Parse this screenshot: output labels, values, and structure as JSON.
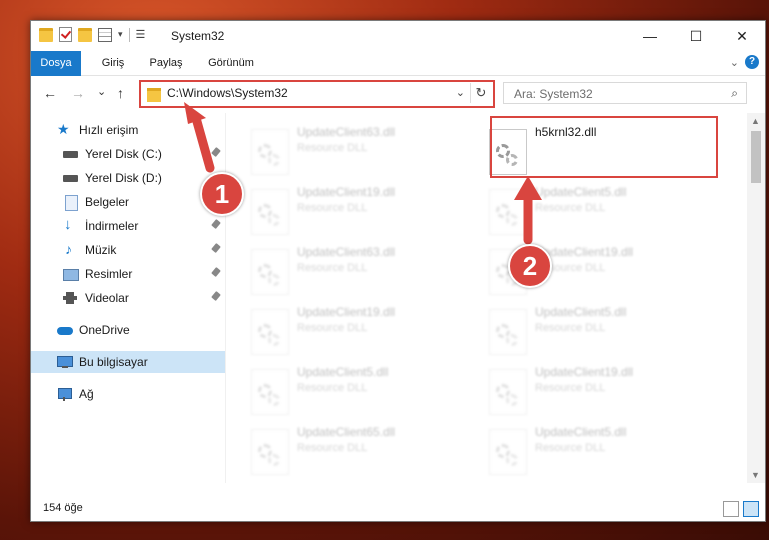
{
  "window": {
    "title": "System32",
    "controls": {
      "minimize": "—",
      "maximize": "☐",
      "close": "✕"
    }
  },
  "ribbon": {
    "tabs": [
      "Dosya",
      "Giriş",
      "Paylaş",
      "Görünüm"
    ],
    "help": "?"
  },
  "nav": {
    "back": "←",
    "forward": "→",
    "recent": "⌄",
    "up": "↑",
    "address": "C:\\Windows\\System32",
    "refresh": "↻",
    "search_placeholder": "Ara: System32"
  },
  "sidebar": {
    "items": [
      {
        "label": "Hızlı erişim",
        "icon": "star-icon"
      },
      {
        "label": "Yerel Disk (C:)",
        "icon": "drive-icon"
      },
      {
        "label": "Yerel Disk (D:)",
        "icon": "drive-icon"
      },
      {
        "label": "Belgeler",
        "icon": "documents-icon"
      },
      {
        "label": "İndirmeler",
        "icon": "download-icon"
      },
      {
        "label": "Müzik",
        "icon": "music-icon"
      },
      {
        "label": "Resimler",
        "icon": "pictures-icon"
      },
      {
        "label": "Videolar",
        "icon": "video-icon"
      },
      {
        "label": "OneDrive",
        "icon": "cloud-icon"
      },
      {
        "label": "Bu bilgisayar",
        "icon": "computer-icon"
      },
      {
        "label": "Ağ",
        "icon": "network-icon"
      }
    ]
  },
  "files": [
    {
      "name": "UpdateClient63.dll",
      "type": "Resource DLL"
    },
    {
      "name": "h5krnl32.dll",
      "type": ""
    },
    {
      "name": "UpdateClient19.dll",
      "type": "Resource DLL"
    },
    {
      "name": "UpdateClient5.dll",
      "type": "Resource DLL"
    },
    {
      "name": "UpdateClient63.dll",
      "type": "Resource DLL"
    },
    {
      "name": "UpdateClient19.dll",
      "type": "Resource DLL"
    },
    {
      "name": "UpdateClient19.dll",
      "type": "Resource DLL"
    },
    {
      "name": "UpdateClient5.dll",
      "type": "Resource DLL"
    },
    {
      "name": "UpdateClient5.dll",
      "type": "Resource DLL"
    },
    {
      "name": "UpdateClient19.dll",
      "type": "Resource DLL"
    },
    {
      "name": "UpdateClient65.dll",
      "type": "Resource DLL"
    },
    {
      "name": "UpdateClient5.dll",
      "type": "Resource DLL"
    }
  ],
  "status": {
    "count": "154 öğe"
  },
  "callouts": [
    "1",
    "2"
  ],
  "colors": {
    "accent": "#1979ca",
    "highlight": "#d9453f",
    "selected": "#cce4f7"
  }
}
